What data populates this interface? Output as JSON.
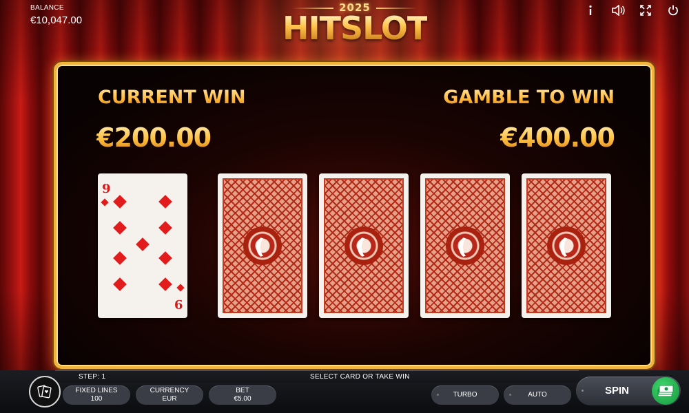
{
  "balance": {
    "label": "BALANCE",
    "value": "€10,047.00"
  },
  "logo": {
    "year": "2025",
    "name": "HITSLOT"
  },
  "top_icons": [
    "info-icon",
    "sound-icon",
    "fullscreen-icon",
    "power-icon"
  ],
  "gamble": {
    "current_win_label": "CURRENT WIN",
    "current_win_amount": "€200.00",
    "gamble_label": "GAMBLE TO WIN",
    "gamble_amount": "€400.00",
    "dealer_card": {
      "rank": "9",
      "suit": "diamonds"
    },
    "face_down_cards": 4
  },
  "status": {
    "step": "STEP: 1",
    "message": "SELECT CARD OR TAKE WIN"
  },
  "controls": {
    "fixed_lines_label": "FIXED LINES",
    "fixed_lines_value": "100",
    "currency_label": "CURRENCY",
    "currency_value": "EUR",
    "bet_label": "BET",
    "bet_value": "€5.00",
    "turbo_label": "TURBO",
    "auto_label": "AUTO",
    "spin_label": "SPIN"
  },
  "colors": {
    "gold": "#f3b43a",
    "red": "#e21c1c",
    "green": "#2bbf55"
  }
}
